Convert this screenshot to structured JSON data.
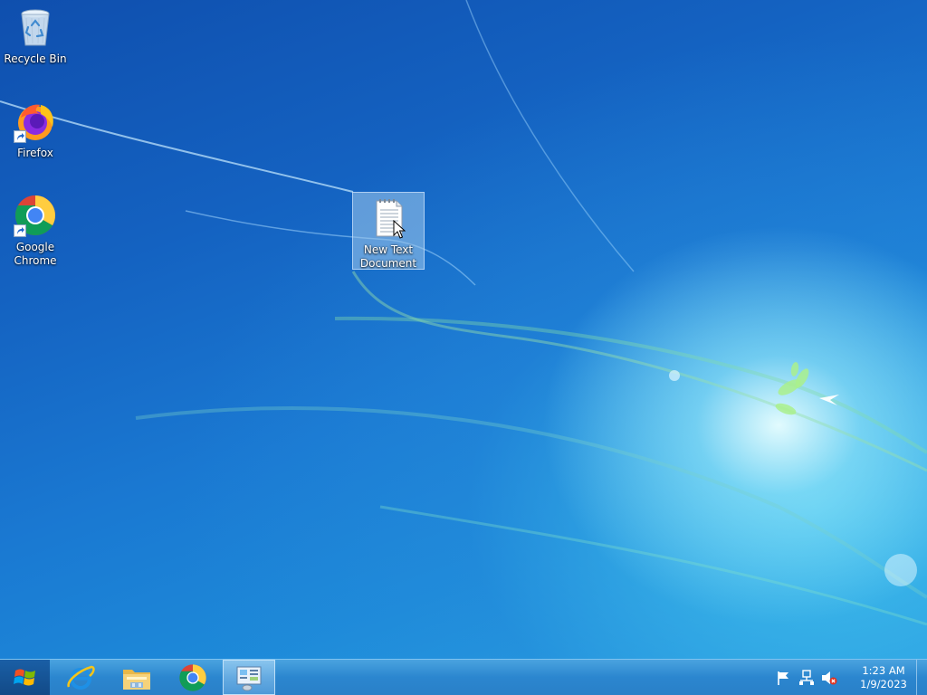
{
  "desktop": {
    "icons": [
      {
        "label": "Recycle Bin",
        "icon": "recycle-bin-icon",
        "shortcut": false
      },
      {
        "label": "Firefox",
        "icon": "firefox-icon",
        "shortcut": true
      },
      {
        "label": "Google Chrome",
        "icon": "chrome-icon",
        "shortcut": true
      },
      {
        "label": "New Text Document",
        "icon": "text-document-icon",
        "shortcut": false,
        "selected": true
      }
    ]
  },
  "taskbar": {
    "start_icon": "windows-logo-icon",
    "pinned": [
      {
        "name": "Internet Explorer",
        "icon": "internet-explorer-icon"
      },
      {
        "name": "File Explorer",
        "icon": "file-explorer-icon"
      },
      {
        "name": "Google Chrome",
        "icon": "chrome-icon"
      },
      {
        "name": "Control Panel",
        "icon": "control-panel-icon",
        "active": true
      }
    ],
    "tray": {
      "icons": [
        "action-center-flag-icon",
        "network-icon",
        "volume-muted-icon"
      ],
      "time": "1:23 AM",
      "date": "1/9/2023"
    }
  },
  "colors": {
    "taskbar": "#2b86cf",
    "start_button": "#124a87",
    "desktop_dark": "#0f4fae",
    "desktop_light": "#2aa5e3"
  }
}
